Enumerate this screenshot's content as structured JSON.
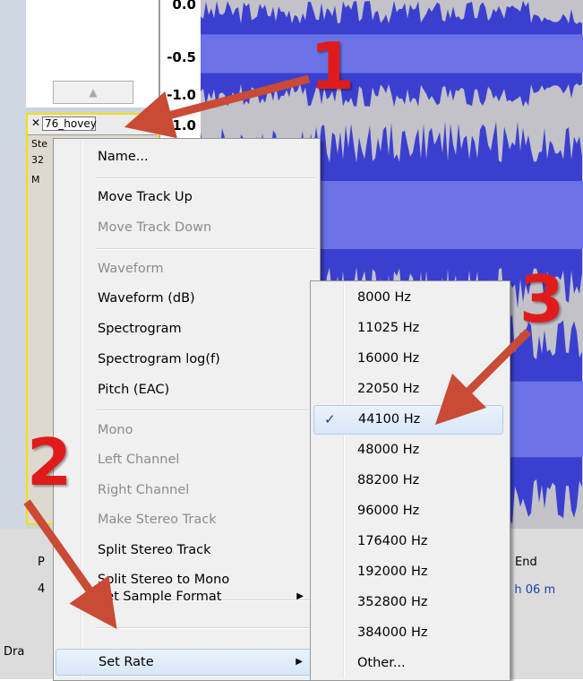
{
  "ruler": {
    "tick_top": "0.0",
    "tick_mid": "-0.5",
    "tick_low": "-1.0",
    "tick_track2": "1.0"
  },
  "track": {
    "name": "76_hovey",
    "info1": "Ste",
    "info2": "32",
    "info3": "M"
  },
  "bottom": {
    "end_label": "End",
    "time_text": "0 h 06 m",
    "left_label": "P",
    "num_label": "4",
    "status_text": "Dra"
  },
  "context_menu": {
    "items": [
      {
        "label": "Name...",
        "disabled": false
      },
      {
        "label": "Move Track Up",
        "disabled": false
      },
      {
        "label": "Move Track Down",
        "disabled": true
      },
      {
        "label": "Waveform",
        "disabled": true
      },
      {
        "label": "Waveform (dB)",
        "disabled": false
      },
      {
        "label": "Spectrogram",
        "disabled": false
      },
      {
        "label": "Spectrogram log(f)",
        "disabled": false
      },
      {
        "label": "Pitch (EAC)",
        "disabled": false
      },
      {
        "label": "Mono",
        "disabled": true
      },
      {
        "label": "Left Channel",
        "disabled": true
      },
      {
        "label": "Right Channel",
        "disabled": true
      },
      {
        "label": "Make Stereo Track",
        "disabled": true
      },
      {
        "label": "Split Stereo Track",
        "disabled": false
      },
      {
        "label": "Split Stereo to Mono",
        "disabled": false
      },
      {
        "label": "Set Sample Format",
        "disabled": false
      },
      {
        "label": "Set Rate",
        "disabled": false
      }
    ]
  },
  "rate_submenu": {
    "items": [
      "8000 Hz",
      "11025 Hz",
      "16000 Hz",
      "22050 Hz",
      "44100 Hz",
      "48000 Hz",
      "88200 Hz",
      "96000 Hz",
      "176400 Hz",
      "192000 Hz",
      "352800 Hz",
      "384000 Hz",
      "Other..."
    ],
    "checked": "44100 Hz",
    "check_glyph": "✓"
  },
  "annotations": {
    "n1": "1",
    "n2": "2",
    "n3": "3",
    "color": "#e01b1b"
  },
  "icons": {
    "close": "close-icon",
    "collapse": "triangle-up-icon",
    "submenu_arrow": "chevron-right-icon"
  }
}
